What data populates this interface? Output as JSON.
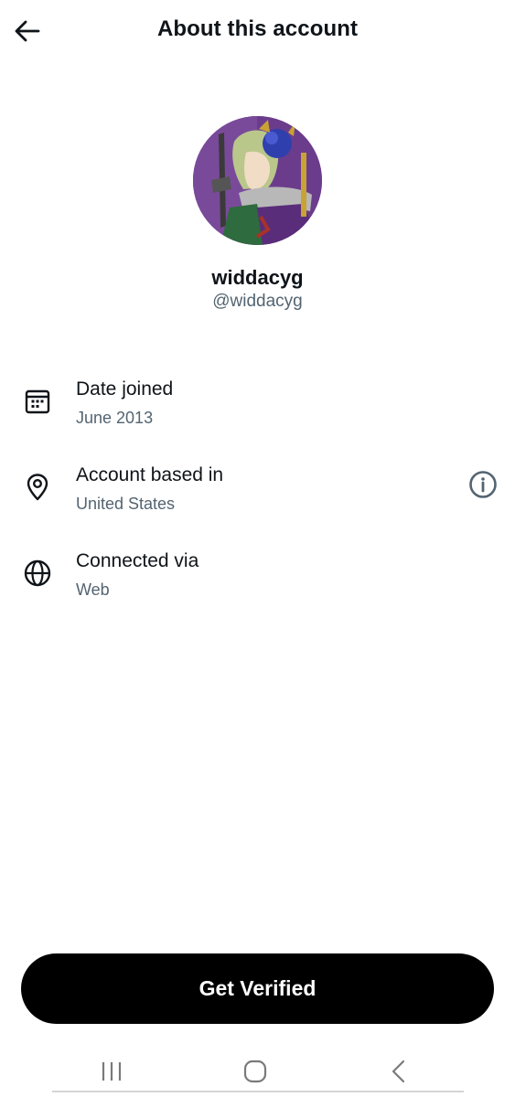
{
  "header": {
    "title": "About this account",
    "back_icon": "arrow-left-icon"
  },
  "profile": {
    "display_name": "widdacyg",
    "handle": "@widdacyg",
    "avatar_bg": "#6b3c8c"
  },
  "info_rows": [
    {
      "icon": "calendar-icon",
      "label": "Date joined",
      "value": "June 2013"
    },
    {
      "icon": "location-pin-icon",
      "label": "Account based in",
      "value": "United States",
      "action_icon": "info-circle-icon"
    },
    {
      "icon": "globe-icon",
      "label": "Connected via",
      "value": "Web"
    }
  ],
  "cta": {
    "label": "Get Verified",
    "bg": "#000000",
    "fg": "#ffffff"
  },
  "system_nav": {
    "recents_icon": "recents-icon",
    "home_icon": "home-icon",
    "back_icon": "back-chevron-icon"
  },
  "colors": {
    "text_primary": "#0f1419",
    "text_secondary": "#536471"
  }
}
